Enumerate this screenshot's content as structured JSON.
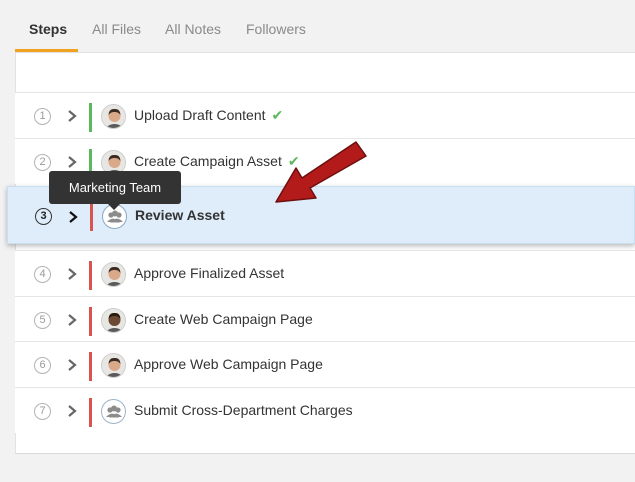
{
  "tabs": [
    {
      "label": "Steps",
      "active": true
    },
    {
      "label": "All Files",
      "active": false
    },
    {
      "label": "All Notes",
      "active": false
    },
    {
      "label": "Followers",
      "active": false
    }
  ],
  "steps": [
    {
      "number": "1",
      "title": "Upload Draft Content",
      "completed": true,
      "assignee": "person",
      "status_color": "#5cb85c"
    },
    {
      "number": "2",
      "title": "Create Campaign Asset",
      "completed": true,
      "assignee": "person",
      "status_color": "#5cb85c"
    },
    {
      "number": "3",
      "title": "Review Asset",
      "completed": false,
      "assignee": "group",
      "status_color": "#d9534f",
      "highlighted": true
    },
    {
      "number": "4",
      "title": "Approve Finalized Asset",
      "completed": false,
      "assignee": "person",
      "status_color": "#d9534f"
    },
    {
      "number": "5",
      "title": "Create Web Campaign Page",
      "completed": false,
      "assignee": "person",
      "status_color": "#d9534f"
    },
    {
      "number": "6",
      "title": "Approve Web Campaign Page",
      "completed": false,
      "assignee": "person",
      "status_color": "#d9534f"
    },
    {
      "number": "7",
      "title": "Submit Cross-Department Charges",
      "completed": false,
      "assignee": "group",
      "status_color": "#d9534f"
    }
  ],
  "tooltip": {
    "text": "Marketing Team"
  },
  "colors": {
    "accent": "#f0a321",
    "complete": "#5cb85c",
    "incomplete": "#d9534f",
    "highlight": "#deedf9",
    "arrow": "#b31b1b"
  }
}
